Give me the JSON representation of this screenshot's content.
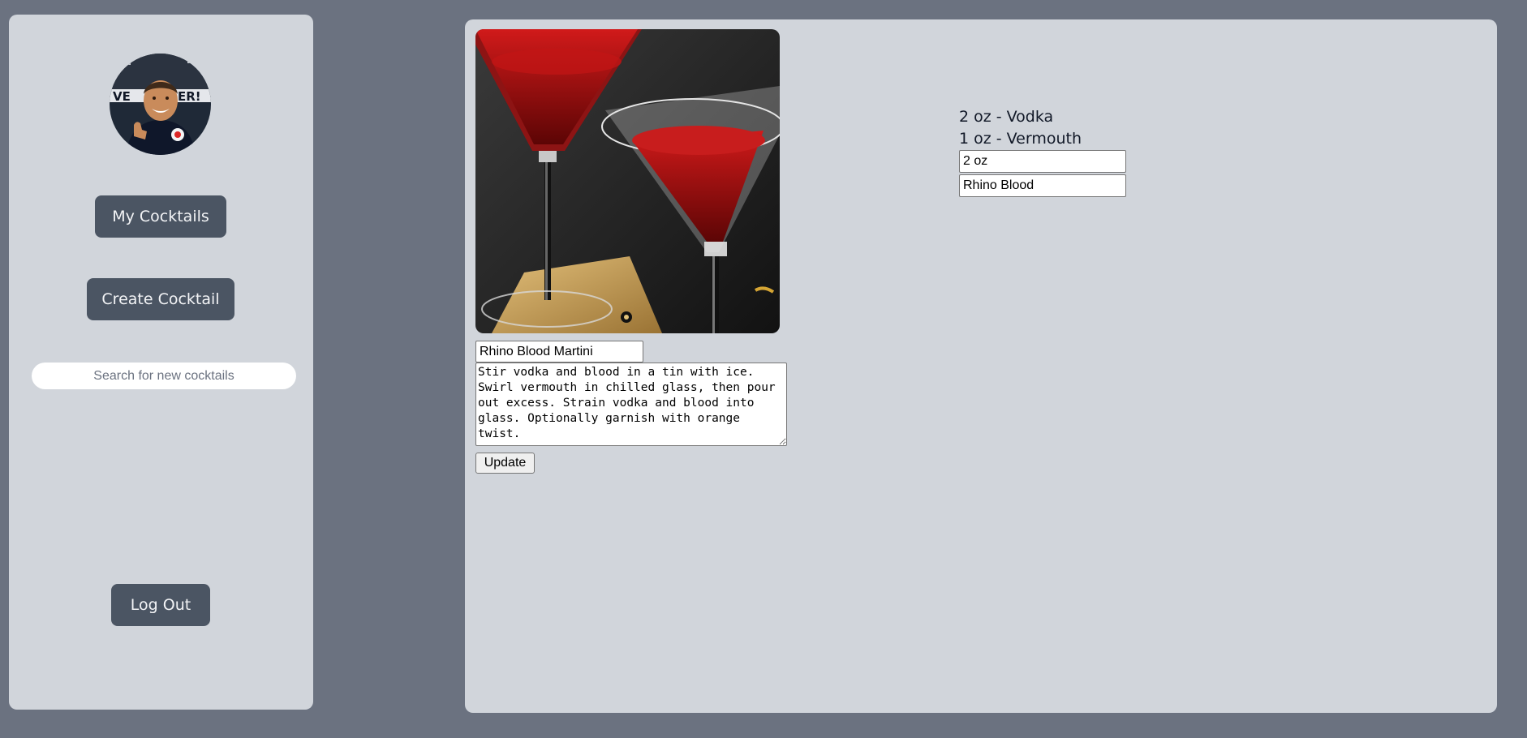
{
  "sidebar": {
    "avatar_alt": "user avatar",
    "my_cocktails_label": "My Cocktails",
    "create_cocktail_label": "Create Cocktail",
    "search_placeholder": "Search for new cocktails",
    "logout_label": "Log Out"
  },
  "cocktail": {
    "name": "Rhino Blood Martini",
    "instructions": "Stir vodka and blood in a tin with ice. Swirl vermouth in chilled glass, then pour out excess. Strain vodka and blood into glass. Optionally garnish with orange twist.",
    "update_label": "Update",
    "ingredients": [
      {
        "text": "2 oz - Vodka"
      },
      {
        "text": "1 oz - Vermouth"
      }
    ],
    "new_ingredient": {
      "amount": "2 oz",
      "name": "Rhino Blood"
    }
  },
  "colors": {
    "page_background": "#6b7280",
    "panel_background": "#d1d5db",
    "nav_button": "#4b5563",
    "nav_button_text": "#f3f4f6"
  }
}
